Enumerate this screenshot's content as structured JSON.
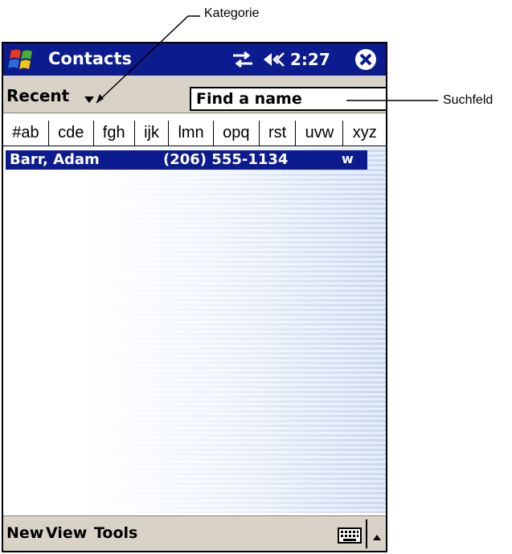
{
  "callouts": {
    "category_label": "Kategorie",
    "search_label": "Suchfeld"
  },
  "titlebar": {
    "app_title": "Contacts",
    "time": "2:27",
    "icons": [
      "start-flag-icon",
      "sync-icon",
      "volume-icon",
      "close-icon"
    ]
  },
  "toolbar": {
    "category": "Recent",
    "search_placeholder": "Find a name"
  },
  "alpha_tabs": [
    "#ab",
    "cde",
    "fgh",
    "ijk",
    "lmn",
    "opq",
    "rst",
    "uvw",
    "xyz"
  ],
  "contacts": [
    {
      "name": "Barr, Adam",
      "phone": "(206) 555-1134",
      "type": "w"
    }
  ],
  "menubar": {
    "items": [
      "New",
      "View",
      "Tools"
    ],
    "icons": [
      "keyboard-icon",
      "arrow-up-icon"
    ]
  },
  "colors": {
    "titlebar": "#0c1b8e",
    "selection": "#0c1b8e",
    "chrome": "#d8d2c7"
  }
}
